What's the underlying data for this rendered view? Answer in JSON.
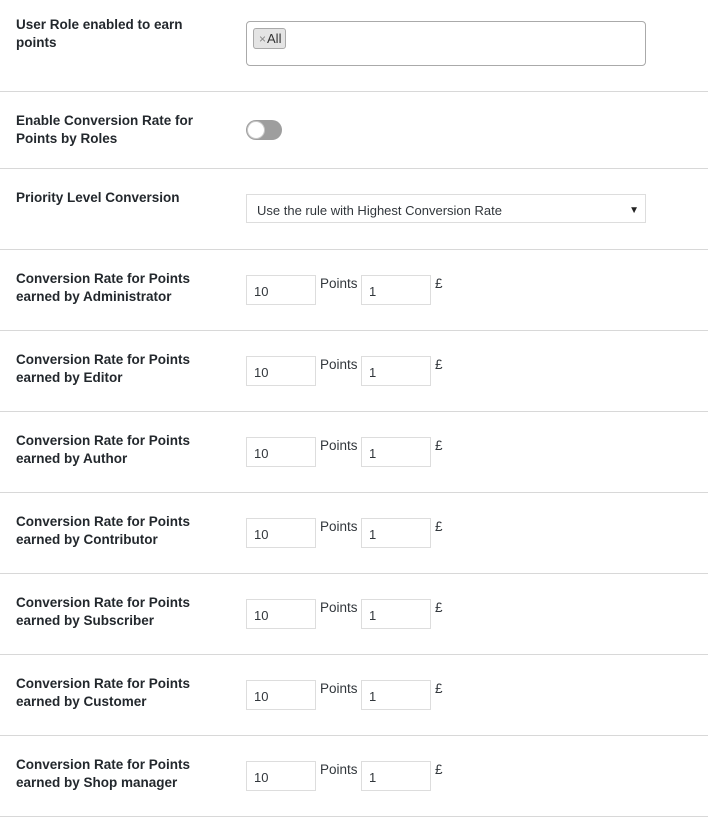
{
  "user_role": {
    "label": "User Role enabled to earn points",
    "tag_remove": "×",
    "tag_value": "All"
  },
  "enable_roles": {
    "label": "Enable Conversion Rate for Points by Roles",
    "enabled": false
  },
  "priority": {
    "label": "Priority Level Conversion",
    "selected": "Use the rule with Highest Conversion Rate",
    "caret": "▼"
  },
  "rates": [
    {
      "label": "Conversion Rate for Points earned by Administrator",
      "points": "10",
      "points_unit": "Points",
      "currency_value": "1",
      "currency_symbol": "£"
    },
    {
      "label": "Conversion Rate for Points earned by Editor",
      "points": "10",
      "points_unit": "Points",
      "currency_value": "1",
      "currency_symbol": "£"
    },
    {
      "label": "Conversion Rate for Points earned by Author",
      "points": "10",
      "points_unit": "Points",
      "currency_value": "1",
      "currency_symbol": "£"
    },
    {
      "label": "Conversion Rate for Points earned by Contributor",
      "points": "10",
      "points_unit": "Points",
      "currency_value": "1",
      "currency_symbol": "£"
    },
    {
      "label": "Conversion Rate for Points earned by Subscriber",
      "points": "10",
      "points_unit": "Points",
      "currency_value": "1",
      "currency_symbol": "£"
    },
    {
      "label": "Conversion Rate for Points earned by Customer",
      "points": "10",
      "points_unit": "Points",
      "currency_value": "1",
      "currency_symbol": "£"
    },
    {
      "label": "Conversion Rate for Points earned by Shop manager",
      "points": "10",
      "points_unit": "Points",
      "currency_value": "1",
      "currency_symbol": "£"
    }
  ]
}
